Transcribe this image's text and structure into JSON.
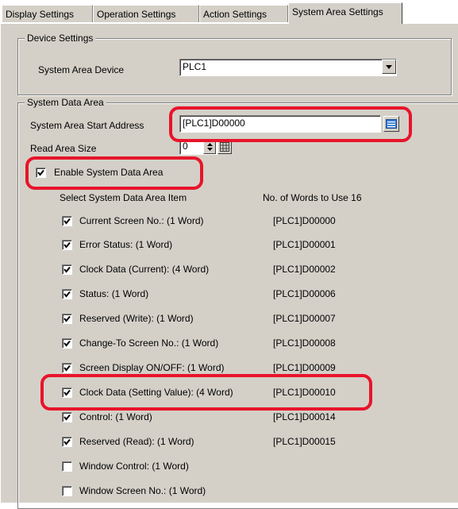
{
  "tabs": [
    {
      "label": "Display Settings"
    },
    {
      "label": "Operation Settings"
    },
    {
      "label": "Action Settings"
    },
    {
      "label": "System Area Settings"
    }
  ],
  "device_settings": {
    "title": "Device Settings",
    "device_label": "System Area Device",
    "device_value": "PLC1"
  },
  "system_data_area": {
    "title": "System Data Area",
    "start_address_label": "System Area Start Address",
    "start_address_value": "[PLC1]D00000",
    "read_area_label": "Read Area Size",
    "read_area_value": "0",
    "enable_label": "Enable System Data Area",
    "enable_checked": true,
    "select_header": "Select System Data Area Item",
    "words_header": "No. of Words to Use 16",
    "items": [
      {
        "label": "Current Screen No.: (1 Word)",
        "address": "[PLC1]D00000",
        "checked": true
      },
      {
        "label": "Error Status: (1 Word)",
        "address": "[PLC1]D00001",
        "checked": true
      },
      {
        "label": "Clock Data (Current): (4 Word)",
        "address": "[PLC1]D00002",
        "checked": true
      },
      {
        "label": "Status: (1 Word)",
        "address": "[PLC1]D00006",
        "checked": true
      },
      {
        "label": "Reserved (Write): (1 Word)",
        "address": "[PLC1]D00007",
        "checked": true
      },
      {
        "label": "Change-To Screen No.: (1 Word)",
        "address": "[PLC1]D00008",
        "checked": true
      },
      {
        "label": "Screen Display ON/OFF: (1 Word)",
        "address": "[PLC1]D00009",
        "checked": true
      },
      {
        "label": "Clock Data (Setting Value): (4 Word)",
        "address": "[PLC1]D00010",
        "checked": true
      },
      {
        "label": "Control: (1 Word)",
        "address": "[PLC1]D00014",
        "checked": true
      },
      {
        "label": "Reserved (Read): (1 Word)",
        "address": "[PLC1]D00015",
        "checked": true
      },
      {
        "label": "Window Control: (1 Word)",
        "address": "",
        "checked": false
      },
      {
        "label": "Window Screen No.: (1 Word)",
        "address": "",
        "checked": false
      }
    ]
  },
  "colors": {
    "panel": "#d4d0c8",
    "highlight": "#e8142a"
  }
}
